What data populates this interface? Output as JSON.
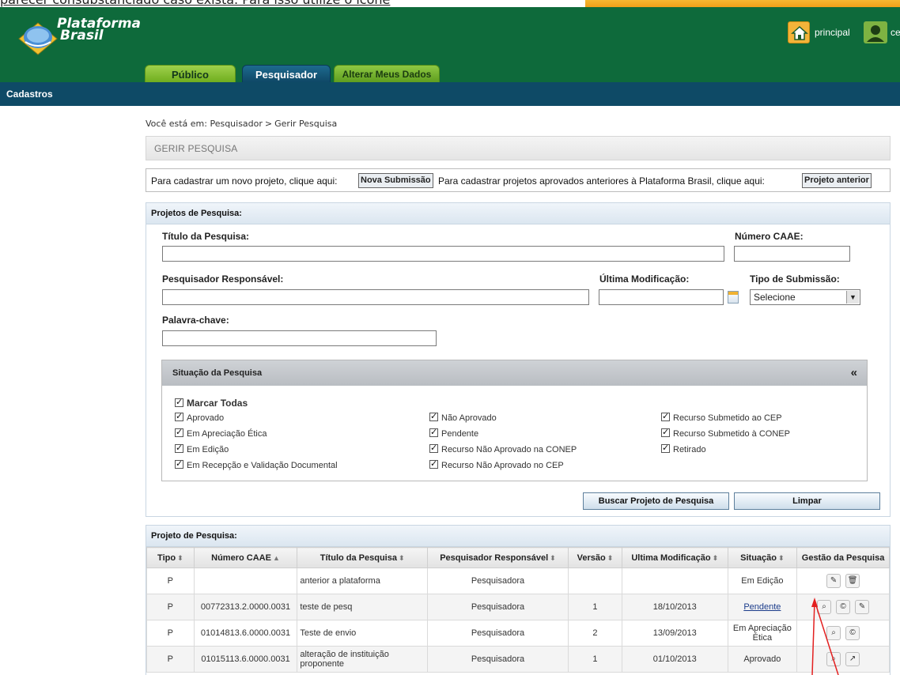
{
  "caption": "parecer consubstanciado caso exista. Para isso utilize o ícone",
  "header": {
    "logo_line1": "Plataforma",
    "logo_line2": "Brasil",
    "home_label": "principal",
    "user_label": "ce"
  },
  "tabs": [
    "Público",
    "Pesquisador",
    "Alterar Meus Dados"
  ],
  "nav": {
    "label": "Cadastros"
  },
  "breadcrumb": {
    "prefix": "Você está em:",
    "level1": "Pesquisador",
    "level2": "Gerir Pesquisa"
  },
  "page_title": "GERIR PESQUISA",
  "info": {
    "text1": "Para cadastrar um novo projeto, clique aqui:",
    "btn1": "Nova Submissão",
    "text2": "Para cadastrar projetos aprovados anteriores à Plataforma Brasil, clique aqui:",
    "btn2": "Projeto anterior"
  },
  "search": {
    "panel_title": "Projetos de Pesquisa:",
    "titulo_label": "Título da Pesquisa:",
    "caae_label": "Número CAAE:",
    "resp_label": "Pesquisador Responsável:",
    "mod_label": "Última Modificação:",
    "tipo_label": "Tipo de Submissão:",
    "tipo_value": "Selecione",
    "palavra_label": "Palavra-chave:"
  },
  "situacao": {
    "title": "Situação da Pesquisa",
    "collapse": "«",
    "marcar_todas": "Marcar Todas",
    "col1": [
      "Aprovado",
      "Em Apreciação Ética",
      "Em Edição",
      "Em Recepção e Validação Documental"
    ],
    "col2": [
      "Não Aprovado",
      "Pendente",
      "Recurso Não Aprovado na CONEP",
      "Recurso Não Aprovado no CEP"
    ],
    "col3": [
      "Recurso Submetido ao CEP",
      "Recurso Submetido à CONEP",
      "Retirado"
    ]
  },
  "actions": {
    "buscar": "Buscar Projeto de Pesquisa",
    "limpar": "Limpar"
  },
  "results": {
    "panel_title": "Projeto de Pesquisa:",
    "columns": [
      "Tipo",
      "Número CAAE",
      "Título da Pesquisa",
      "Pesquisador Responsável",
      "Versão",
      "Ultima Modificação",
      "Situação",
      "Gestão da Pesquisa"
    ],
    "rows": [
      {
        "tipo": "P",
        "caae": "",
        "titulo": "anterior a plataforma",
        "resp": "Pesquisadora",
        "versao": "",
        "mod": "",
        "situacao": "Em Edição"
      },
      {
        "tipo": "P",
        "caae": "00772313.2.0000.0031",
        "titulo": "teste de pesq",
        "resp": "Pesquisadora",
        "versao": "1",
        "mod": "18/10/2013",
        "situacao": "Pendente"
      },
      {
        "tipo": "P",
        "caae": "01014813.6.0000.0031",
        "titulo": "Teste de envio",
        "resp": "Pesquisadora",
        "versao": "2",
        "mod": "13/09/2013",
        "situacao": "Em Apreciação Ética"
      },
      {
        "tipo": "P",
        "caae": "01015113.6.0000.0031",
        "titulo": "alteração de instituição proponente",
        "resp": "Pesquisadora",
        "versao": "1",
        "mod": "01/10/2013",
        "situacao": "Aprovado"
      }
    ]
  }
}
